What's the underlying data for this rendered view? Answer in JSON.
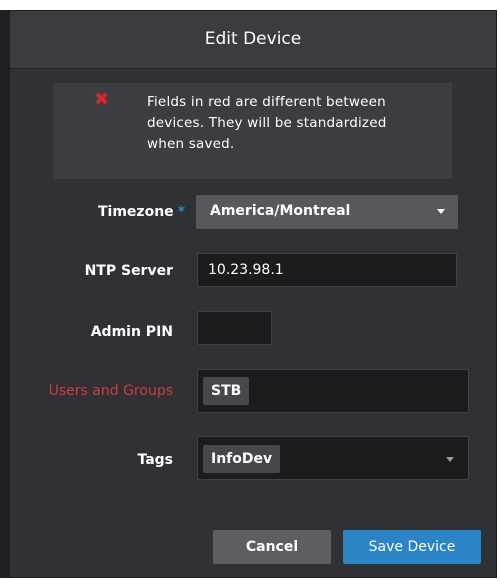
{
  "dialog": {
    "title": "Edit Device",
    "warning": {
      "icon": "error-x-icon",
      "text": "Fields in red are different between devices. They will be standardized when saved."
    }
  },
  "fields": {
    "timezone": {
      "label": "Timezone",
      "required_marker": "*",
      "value": "America/Montreal"
    },
    "ntp_server": {
      "label": "NTP Server",
      "value": "10.23.98.1"
    },
    "admin_pin": {
      "label": "Admin PIN",
      "value": ""
    },
    "users_groups": {
      "label": "Users and Groups",
      "tags": [
        "STB"
      ]
    },
    "tags": {
      "label": "Tags",
      "tags": [
        "InfoDev"
      ]
    }
  },
  "buttons": {
    "cancel": "Cancel",
    "save": "Save Device"
  },
  "colors": {
    "dialog_bg": "#2f3134",
    "header_bg": "#3a3c3f",
    "warning_bg": "#3b3d40",
    "error_red": "#d23a42",
    "accent_blue": "#2a84c6",
    "input_bg": "#1b1c1e"
  }
}
